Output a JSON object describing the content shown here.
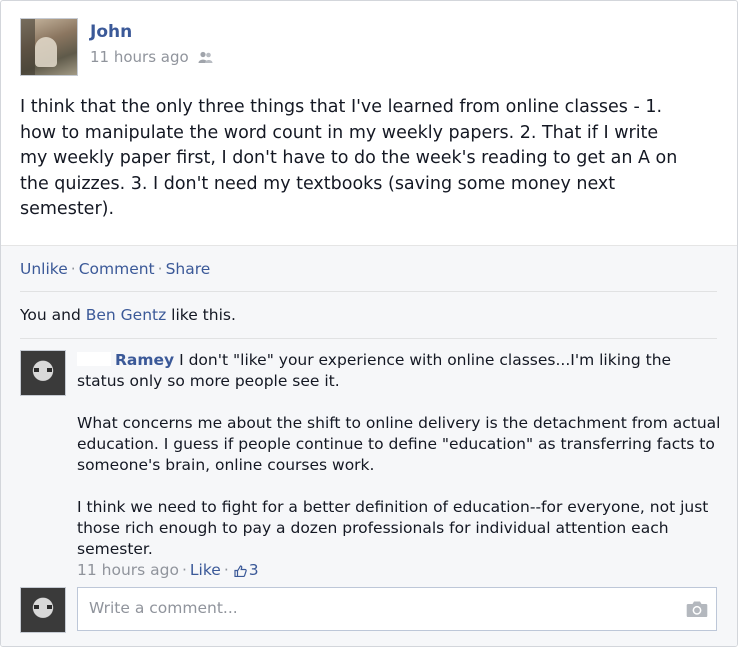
{
  "post": {
    "author": "John",
    "time": "11 hours ago",
    "audience_icon": "friends-icon",
    "text_lines": [
      "I think that the only three things that I've learned from online classes - 1.",
      "how to manipulate the word count in my weekly papers. 2. That if I write",
      "my weekly paper first, I don't have to do the week's reading to get an A on",
      "the quizzes. 3. I don't need my textbooks (saving some money next",
      "semester)."
    ]
  },
  "actions": {
    "unlike": "Unlike",
    "comment": "Comment",
    "share": "Share",
    "separator": "·"
  },
  "likes": {
    "prefix": "You and ",
    "person": "Ben Gentz",
    "suffix": " like this."
  },
  "comment": {
    "author": "Ramey",
    "first_line": " I don't \"like\" your experience with online classes...I'm liking the",
    "lines": [
      "status only so more people see it.",
      "",
      "What concerns me about the shift to online delivery is the detachment from actual",
      "education. I guess if people continue to define \"education\" as transferring facts to",
      "someone's brain, online courses work.",
      "",
      "I think we need to fight for a better definition of education--for everyone, not just",
      "those rich enough to pay a dozen professionals for individual attention each",
      "semester."
    ],
    "time": "11 hours ago",
    "like_label": "Like",
    "like_count": "3",
    "separator": "·"
  },
  "write_comment": {
    "placeholder": "Write a comment...",
    "camera_icon": "camera-icon"
  },
  "colors": {
    "link": "#3b5998",
    "muted": "#90949c",
    "text": "#141823",
    "feedback_bg": "#f6f7f9"
  }
}
